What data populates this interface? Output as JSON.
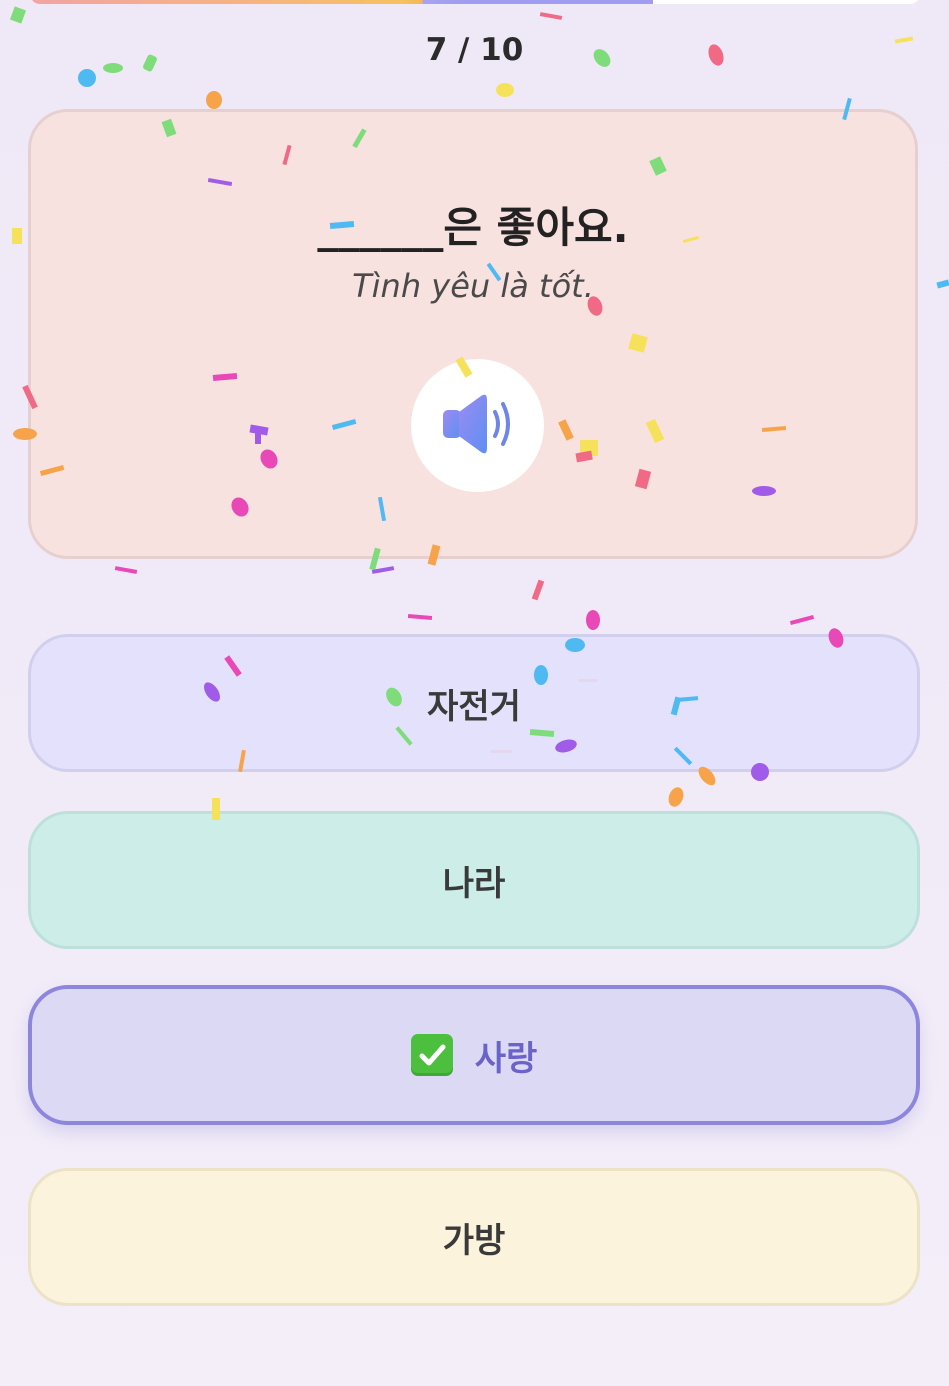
{
  "progress": {
    "counter": "7 / 10",
    "fraction": 0.7
  },
  "question": {
    "korean": "______은 좋아요.",
    "translation": "Tình yêu là tốt.",
    "audio_icon": "speaker-icon"
  },
  "options": [
    {
      "label": "자전거",
      "state": "default"
    },
    {
      "label": "나라",
      "state": "default"
    },
    {
      "label": "사랑",
      "state": "correct",
      "icon": "check-mark-icon"
    },
    {
      "label": "가방",
      "state": "default"
    }
  ],
  "colors": {
    "card_question": "#f8e2e0",
    "option_1": "#e3e1fb",
    "option_2": "#cdeee8",
    "option_3_selected": "#dcd9f4",
    "option_3_border": "#8c86dc",
    "option_4": "#fbf3dc",
    "check_green": "#4cbf3f"
  }
}
